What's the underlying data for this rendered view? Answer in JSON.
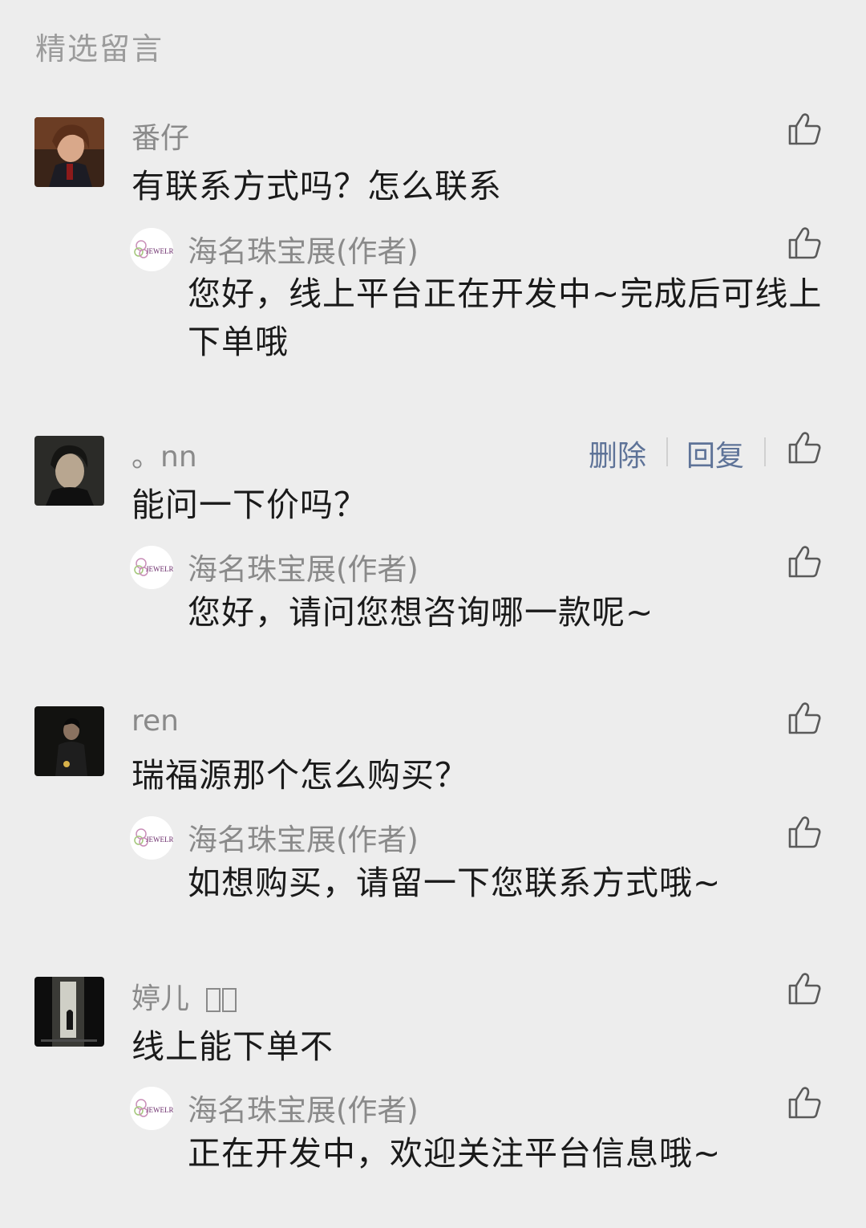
{
  "section_title": "精选留言",
  "comments": [
    {
      "nickname": "番仔",
      "content": "有联系方式吗？怎么联系",
      "reply": {
        "author": "海名珠宝展(作者)",
        "content": "您好，线上平台正在开发中~完成后可线上下单哦"
      }
    },
    {
      "nickname": "。nn",
      "content": "能问一下价吗？",
      "actions": {
        "delete": "删除",
        "reply": "回复"
      },
      "reply": {
        "author": "海名珠宝展(作者)",
        "content": "您好，请问您想咨询哪一款呢~"
      }
    },
    {
      "nickname": "ren",
      "content": "瑞福源那个怎么购买？",
      "reply": {
        "author": "海名珠宝展(作者)",
        "content": "如想购买，请留一下您联系方式哦~"
      }
    },
    {
      "nickname": "婷儿",
      "content": "线上能下单不",
      "reply": {
        "author": "海名珠宝展(作者)",
        "content": "正在开发中，欢迎关注平台信息哦~"
      }
    }
  ],
  "logo_text": "JEWELRY",
  "icons": {
    "like": "thumbs-up-icon"
  },
  "colors": {
    "background": "#ededed",
    "link": "#5e7398",
    "secondary_text": "#8a8a8a",
    "primary_text": "#1a1a1a"
  }
}
